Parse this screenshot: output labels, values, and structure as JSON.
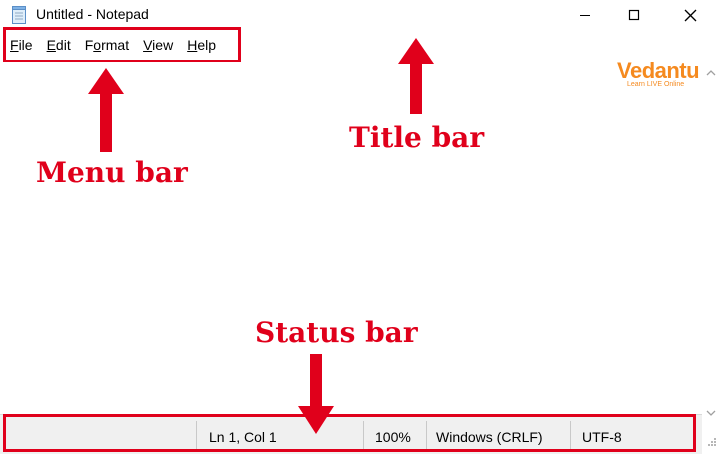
{
  "window": {
    "title": "Untitled - Notepad",
    "icon": "notepad-icon",
    "controls": {
      "minimize_icon": "minimize-icon",
      "maximize_icon": "maximize-icon",
      "close_icon": "close-icon"
    }
  },
  "menu": {
    "items": [
      {
        "pre": "",
        "accel": "F",
        "post": "ile"
      },
      {
        "pre": "",
        "accel": "E",
        "post": "dit"
      },
      {
        "pre": "F",
        "accel": "o",
        "post": "rmat"
      },
      {
        "pre": "",
        "accel": "V",
        "post": "iew"
      },
      {
        "pre": "",
        "accel": "H",
        "post": "elp"
      }
    ]
  },
  "editor": {
    "content": ""
  },
  "status_bar": {
    "position": "Ln 1, Col 1",
    "zoom": "100%",
    "line_endings": "Windows (CRLF)",
    "encoding": "UTF-8"
  },
  "annotations": {
    "title_bar": "Title bar",
    "menu_bar": "Menu bar",
    "status_bar": "Status bar"
  },
  "logo": {
    "text": "Vedantu",
    "tagline": "Learn LIVE Online"
  },
  "colors": {
    "annotation": "#e0001b",
    "logo": "#f58a1f",
    "status_bar_bg": "#f0f0f0"
  }
}
